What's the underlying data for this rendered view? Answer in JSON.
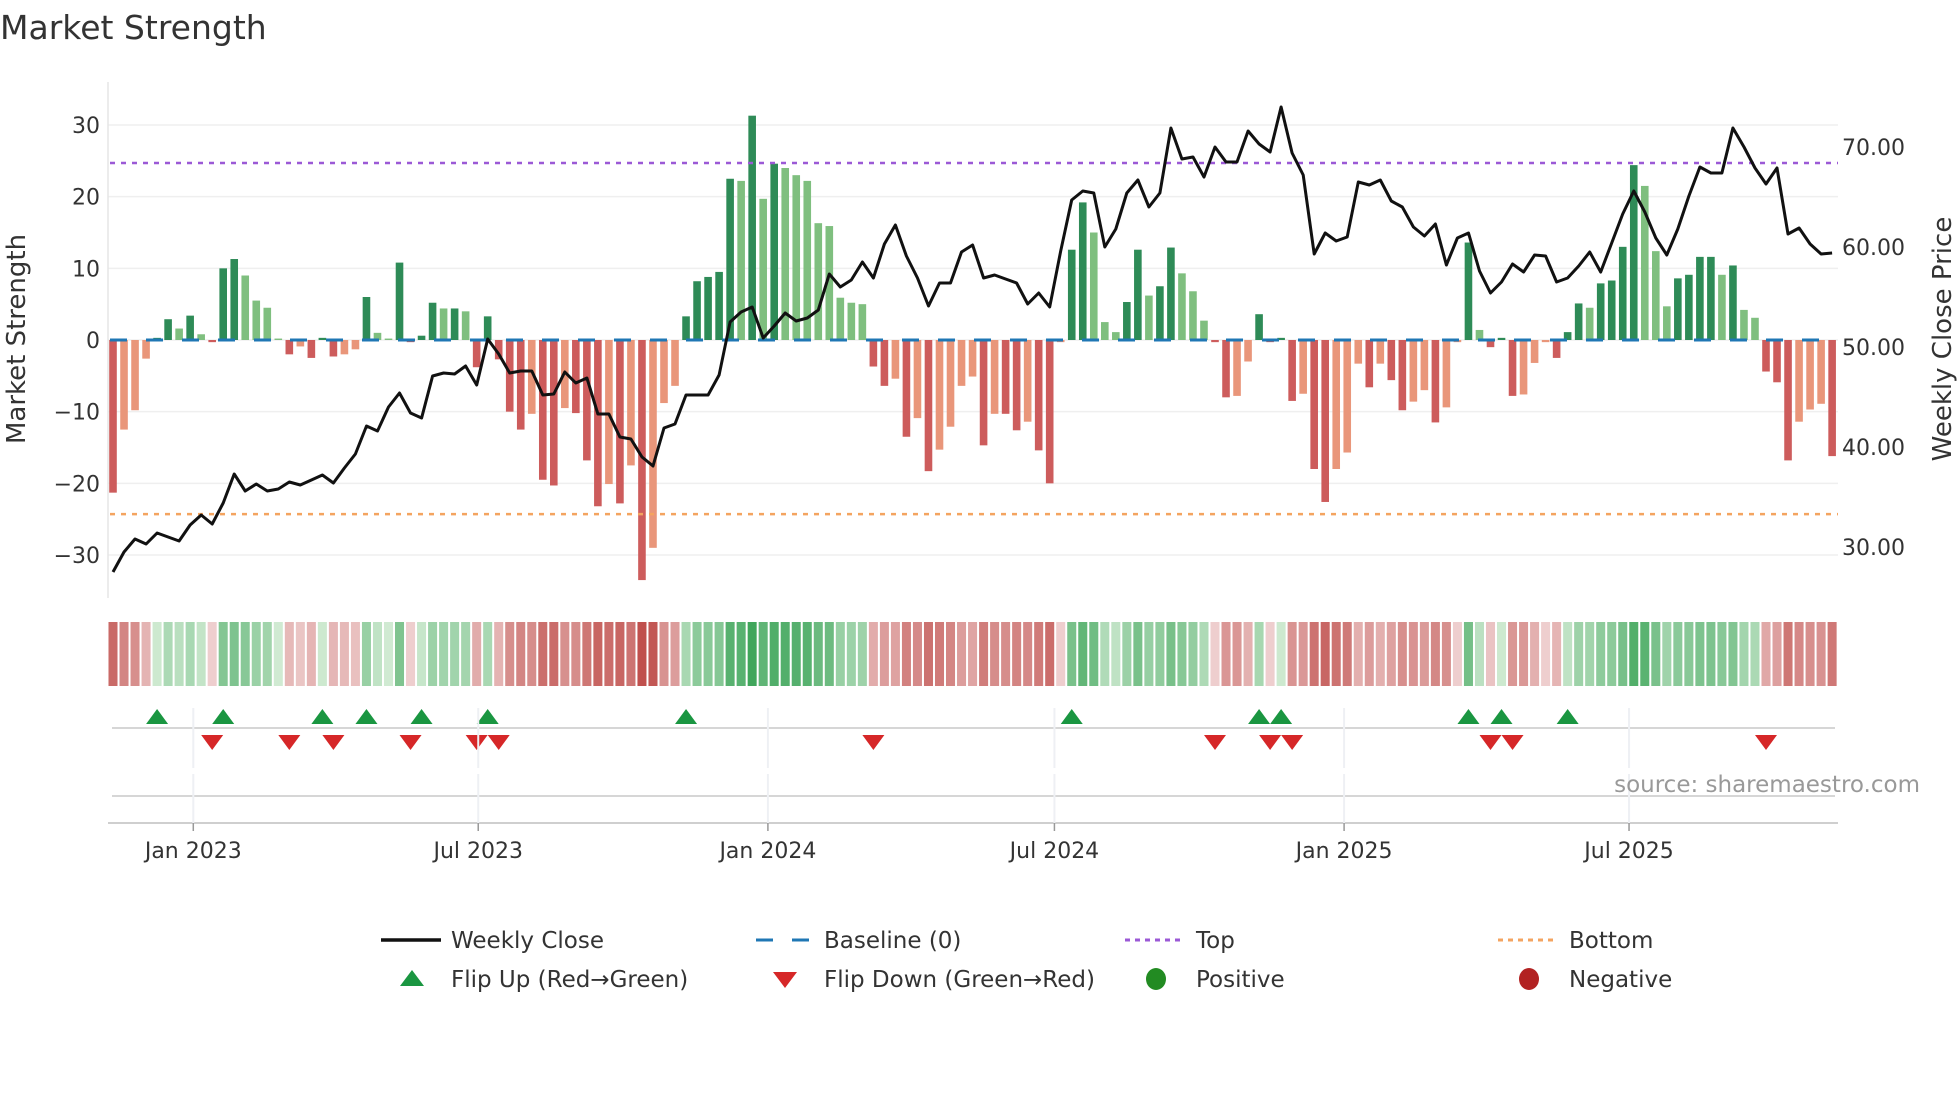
{
  "title": "Market Strength",
  "source": "source: sharemaestro.com",
  "colors": {
    "pos_strong": "#2e8b57",
    "pos_weak": "#7fbf7f",
    "neg_strong": "#cd5c5c",
    "neg_weak": "#e9967a",
    "baseline": "#1f77b4",
    "top": "#9b59d6",
    "bottom": "#f4a460",
    "close": "#111111",
    "flip_up": "#1a9641",
    "flip_down": "#d62728",
    "positive": "#228b22",
    "negative": "#b22222"
  },
  "chart_data": {
    "type": "bar+line",
    "title": "Market Strength",
    "ylabel": "Market Strength",
    "y2label": "Weekly Close Price",
    "frequency": "weekly",
    "x_start": "2022-11-11",
    "ylim": [
      -36,
      36
    ],
    "y2lim": [
      24.9,
      76.5
    ],
    "y_ticks": [
      30,
      20,
      10,
      0,
      -10,
      -20,
      -30
    ],
    "y_tick_labels": [
      "30",
      "20",
      "10",
      "0",
      "−10",
      "−20",
      "−30"
    ],
    "y2_ticks": [
      70,
      60,
      50,
      40,
      30
    ],
    "y2_tick_labels": [
      "70.00",
      "60.00",
      "50.00",
      "40.00",
      "30.00"
    ],
    "x_ticks": [
      {
        "label": "Jan 2023",
        "date": "2023-01-01"
      },
      {
        "label": "Jul 2023",
        "date": "2023-07-01"
      },
      {
        "label": "Jan 2024",
        "date": "2024-01-01"
      },
      {
        "label": "Jul 2024",
        "date": "2024-07-01"
      },
      {
        "label": "Jan 2025",
        "date": "2025-01-01"
      },
      {
        "label": "Jul 2025",
        "date": "2025-07-01"
      }
    ],
    "top_level": 24.7,
    "bottom_level": -24.3,
    "baseline": 0,
    "strength": [
      -21.3,
      -12.5,
      -9.8,
      -2.6,
      0.3,
      2.9,
      1.6,
      3.4,
      0.8,
      -0.3,
      10.0,
      11.3,
      9.0,
      5.5,
      4.5,
      0.2,
      -2.0,
      -0.9,
      -2.5,
      0.3,
      -2.3,
      -2.0,
      -1.3,
      6.0,
      1.0,
      0.2,
      10.8,
      -0.3,
      0.6,
      5.2,
      4.4,
      4.4,
      4.0,
      -3.8,
      3.3,
      -2.7,
      -10.0,
      -12.5,
      -10.3,
      -19.5,
      -20.3,
      -9.5,
      -10.2,
      -16.8,
      -23.2,
      -20.1,
      -22.8,
      -17.5,
      -33.5,
      -29.0,
      -8.8,
      -6.4,
      3.3,
      8.2,
      8.8,
      9.5,
      22.5,
      22.2,
      31.3,
      19.7,
      24.6,
      24.0,
      23.0,
      22.2,
      16.3,
      15.9,
      5.9,
      5.2,
      5.0,
      -3.7,
      -6.4,
      -5.4,
      -13.5,
      -10.9,
      -18.3,
      -15.3,
      -12.1,
      -6.4,
      -5.1,
      -14.7,
      -10.3,
      -10.3,
      -12.6,
      -11.4,
      -15.4,
      -20.0,
      -0.3,
      12.6,
      19.2,
      15.0,
      2.5,
      1.1,
      5.3,
      12.6,
      6.2,
      7.5,
      12.9,
      9.3,
      6.8,
      2.7,
      -0.3,
      -8.0,
      -7.8,
      -3.0,
      3.6,
      -0.3,
      0.3,
      -8.5,
      -7.5,
      -18.0,
      -22.6,
      -18.0,
      -15.7,
      -3.3,
      -6.6,
      -3.3,
      -5.6,
      -9.8,
      -8.6,
      -7.0,
      -11.5,
      -9.4,
      -0.3,
      13.6,
      1.4,
      -1.0,
      0.3,
      -7.8,
      -7.6,
      -3.2,
      -0.3,
      -2.5,
      1.1,
      5.1,
      4.5,
      7.9,
      8.3,
      13.0,
      24.4,
      21.5,
      12.4,
      4.7,
      8.6,
      9.1,
      11.6,
      11.6,
      9.1,
      10.4,
      4.2,
      3.1,
      -4.4,
      -5.9,
      -16.8,
      -11.4,
      -9.7,
      -8.9,
      -16.2
    ],
    "weekly_close": [
      27.5,
      29.5,
      30.8,
      30.3,
      31.4,
      31.0,
      30.6,
      32.2,
      33.2,
      32.3,
      34.4,
      37.3,
      35.6,
      36.3,
      35.6,
      35.8,
      36.5,
      36.2,
      36.7,
      37.2,
      36.4,
      37.9,
      39.3,
      42.1,
      41.6,
      44.0,
      45.4,
      43.4,
      42.9,
      47.1,
      47.4,
      47.3,
      48.1,
      46.2,
      50.8,
      49.3,
      47.4,
      47.6,
      47.6,
      45.2,
      45.3,
      47.5,
      46.4,
      46.9,
      43.3,
      43.3,
      41.0,
      40.8,
      39.0,
      38.1,
      41.9,
      42.3,
      45.2,
      45.2,
      45.2,
      47.2,
      52.5,
      53.5,
      54.0,
      50.9,
      52.1,
      53.4,
      52.6,
      52.9,
      53.7,
      57.3,
      56.0,
      56.7,
      58.5,
      56.9,
      60.3,
      62.2,
      59.1,
      56.9,
      54.1,
      56.4,
      56.4,
      59.5,
      60.2,
      56.9,
      57.2,
      56.8,
      56.4,
      54.3,
      55.4,
      54.0,
      59.6,
      64.7,
      65.6,
      65.4,
      60.0,
      61.8,
      65.4,
      66.7,
      64.0,
      65.4,
      71.9,
      68.8,
      69.0,
      67.0,
      70.0,
      68.5,
      68.5,
      71.6,
      70.3,
      69.5,
      74.0,
      69.4,
      67.2,
      59.3,
      61.4,
      60.6,
      61.0,
      66.5,
      66.2,
      66.7,
      64.6,
      64.0,
      62.0,
      61.1,
      62.3,
      58.2,
      60.9,
      61.4,
      57.6,
      55.4,
      56.5,
      58.3,
      57.5,
      59.2,
      59.1,
      56.5,
      56.9,
      58.1,
      59.5,
      57.5,
      60.4,
      63.3,
      65.6,
      63.5,
      60.9,
      59.2,
      61.8,
      65.1,
      68.0,
      67.4,
      67.4,
      71.9,
      70.0,
      67.9,
      66.3,
      67.9,
      61.3,
      61.9,
      60.3,
      59.3,
      59.4
    ],
    "flip_up_weeks": [
      5,
      11,
      20,
      24,
      29,
      35,
      53,
      88,
      105,
      107,
      124,
      127,
      133
    ],
    "flip_down_weeks": [
      10,
      17,
      21,
      28,
      34,
      36,
      70,
      101,
      106,
      108,
      126,
      128,
      151
    ],
    "legend": {
      "placement": "bottom",
      "items": [
        {
          "label": "Weekly Close",
          "kind": "line"
        },
        {
          "label": "Baseline (0)",
          "kind": "dash"
        },
        {
          "label": "Top",
          "kind": "dot-purple"
        },
        {
          "label": "Bottom",
          "kind": "dot-orange"
        },
        {
          "label": "Flip Up (Red→Green)",
          "kind": "tri-up"
        },
        {
          "label": "Flip Down (Green→Red)",
          "kind": "tri-down"
        },
        {
          "label": "Positive",
          "kind": "circle-pos"
        },
        {
          "label": "Negative",
          "kind": "circle-neg"
        }
      ]
    }
  }
}
